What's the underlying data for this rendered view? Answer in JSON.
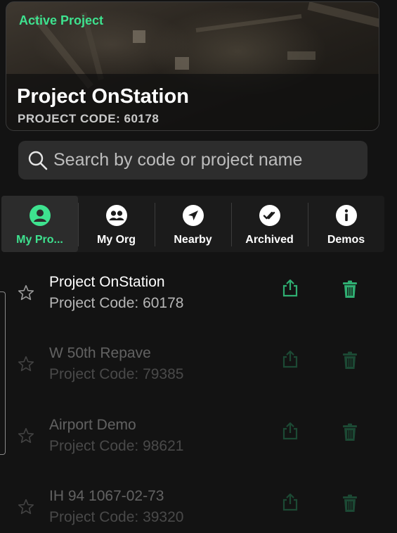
{
  "active_project": {
    "label": "Active Project",
    "title": "Project OnStation",
    "code": "PROJECT CODE: 60178"
  },
  "search": {
    "placeholder": "Search by code or project name",
    "icon": "search-icon"
  },
  "tabs": [
    {
      "label": "My Pro...",
      "icon": "person-icon",
      "selected": true
    },
    {
      "label": "My Org",
      "icon": "group-icon",
      "selected": false
    },
    {
      "label": "Nearby",
      "icon": "navigation-arrow-icon",
      "selected": false
    },
    {
      "label": "Archived",
      "icon": "double-check-icon",
      "selected": false
    },
    {
      "label": "Demos",
      "icon": "info-icon",
      "selected": false
    }
  ],
  "projects": [
    {
      "name": "Project OnStation",
      "code": "Project Code: 60178"
    },
    {
      "name": "W 50th Repave",
      "code": "Project Code: 79385"
    },
    {
      "name": "Airport Demo",
      "code": "Project Code: 98621"
    },
    {
      "name": "IH 94 1067-02-73",
      "code": "Project Code: 39320"
    }
  ],
  "colors": {
    "accent": "#3ee28f",
    "action_icon": "#2fae72",
    "background": "#131313"
  }
}
